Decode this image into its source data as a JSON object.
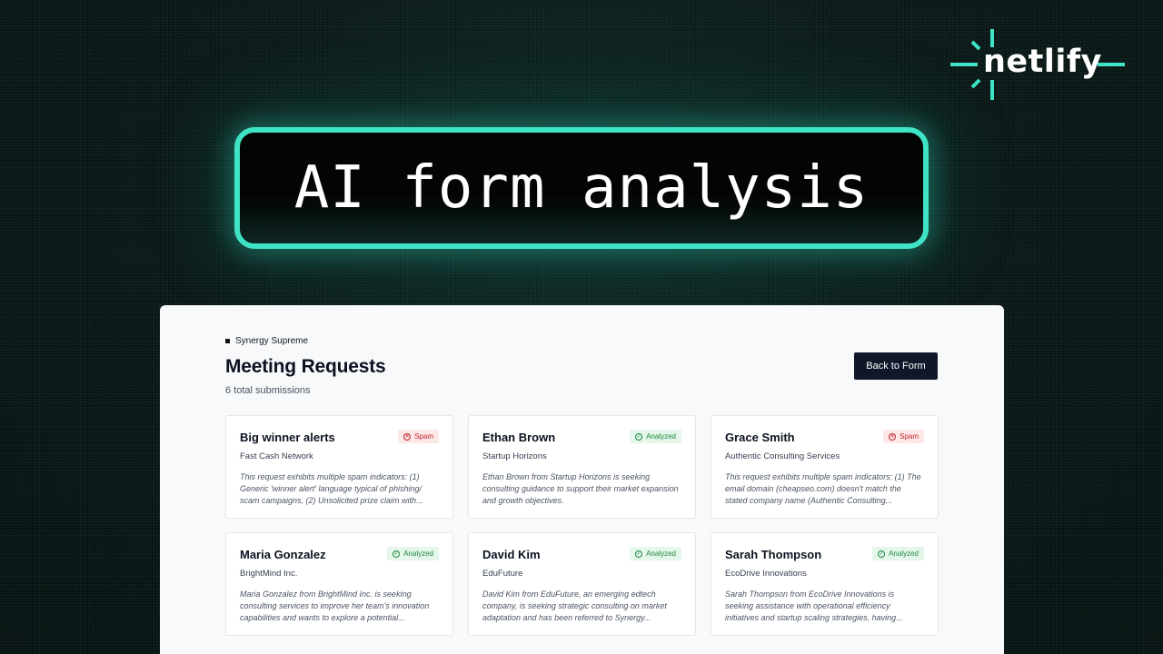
{
  "logo": {
    "text": "netlify",
    "accent": "#3fe3c6"
  },
  "hero": {
    "title": "AI form analysis",
    "border_color": "#3fe3c6"
  },
  "app": {
    "brand": "Synergy Supreme",
    "title": "Meeting Requests",
    "subtitle": "6 total submissions",
    "back_button": "Back to Form"
  },
  "cards": [
    {
      "name": "Big winner alerts",
      "company": "Fast Cash Network",
      "status": "Spam",
      "status_type": "spam",
      "summary": "This request exhibits multiple spam indicators: (1) Generic 'winner alert' language typical of phishing/ scam campaigns, (2) Unsolicited prize claim with..."
    },
    {
      "name": "Ethan Brown",
      "company": "Startup Horizons",
      "status": "Analyzed",
      "status_type": "analyzed",
      "summary": "Ethan Brown from Startup Horizons is seeking consulting guidance to support their market expansion and growth objectives."
    },
    {
      "name": "Grace Smith",
      "company": "Authentic Consulting Services",
      "status": "Spam",
      "status_type": "spam",
      "summary": "This request exhibits multiple spam indicators: (1) The email domain (cheapseo.com) doesn't match the stated company name (Authentic Consulting..."
    },
    {
      "name": "Maria Gonzalez",
      "company": "BrightMind Inc.",
      "status": "Analyzed",
      "status_type": "analyzed",
      "summary": "Maria Gonzalez from BrightMind Inc. is seeking consulting services to improve her team's innovation capabilities and wants to explore a potential..."
    },
    {
      "name": "David Kim",
      "company": "EduFuture",
      "status": "Analyzed",
      "status_type": "analyzed",
      "summary": "David Kim from EduFuture, an emerging edtech company, is seeking strategic consulting on market adaptation and has been referred to Synergy..."
    },
    {
      "name": "Sarah Thompson",
      "company": "EcoDrive Innovations",
      "status": "Analyzed",
      "status_type": "analyzed",
      "summary": "Sarah Thompson from EcoDrive Innovations is seeking assistance with operational efficiency initiatives and startup scaling strategies, having..."
    }
  ]
}
